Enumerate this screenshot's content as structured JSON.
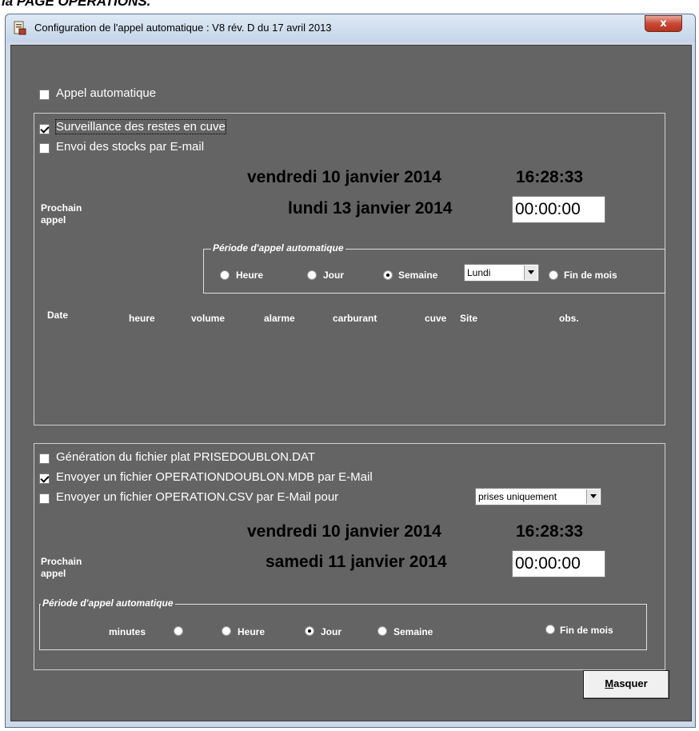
{
  "doc_fragment": "la PAGE OPERATIONS.",
  "window": {
    "title": "Configuration de l'appel automatique : V8 rév. D du 17 avril 2013",
    "close_label": "x"
  },
  "appel_automatique": {
    "label": "Appel automatique",
    "checked": false
  },
  "section1": {
    "surveillance": {
      "label": "Surveillance des restes en cuve",
      "checked": true
    },
    "envoi_stocks": {
      "label": "Envoi des stocks par E-mail",
      "checked": false
    },
    "current_datetime": "vendredi 10 janvier 2014",
    "current_time": "16:28:33",
    "prochain_label_1": "Prochain",
    "prochain_label_2": "appel",
    "next_date": "lundi 13 janvier 2014",
    "next_time": "00:00:00",
    "periode": {
      "title": "Période d'appel automatique",
      "options": [
        "Heure",
        "Jour",
        "Semaine",
        "Fin de mois"
      ],
      "selected": "Semaine",
      "weekday_value": "Lundi"
    },
    "columns": [
      "Date",
      "heure",
      "volume",
      "alarme",
      "carburant",
      "cuve",
      "Site",
      "obs."
    ]
  },
  "section2": {
    "generation": {
      "label": "Génération du fichier plat PRISEDOUBLON.DAT",
      "checked": false
    },
    "envoyer_mdb": {
      "label": "Envoyer un fichier OPERATIONDOUBLON.MDB par E-Mail",
      "checked": true
    },
    "envoyer_csv": {
      "label": "Envoyer un fichier OPERATION.CSV par E-Mail pour",
      "checked": false
    },
    "csv_filter_value": "prises uniquement",
    "current_datetime": "vendredi 10 janvier 2014",
    "current_time": "16:28:33",
    "prochain_label_1": "Prochain",
    "prochain_label_2": "appel",
    "next_date": "samedi 11 janvier 2014",
    "next_time": "00:00:00",
    "periode": {
      "title": "Période d'appel automatique",
      "options": [
        "minutes",
        "Heure",
        "Jour",
        "Semaine",
        "Fin de mois"
      ],
      "selected": "Jour"
    }
  },
  "masquer_button": {
    "prefix": "M",
    "rest": "asquer"
  }
}
